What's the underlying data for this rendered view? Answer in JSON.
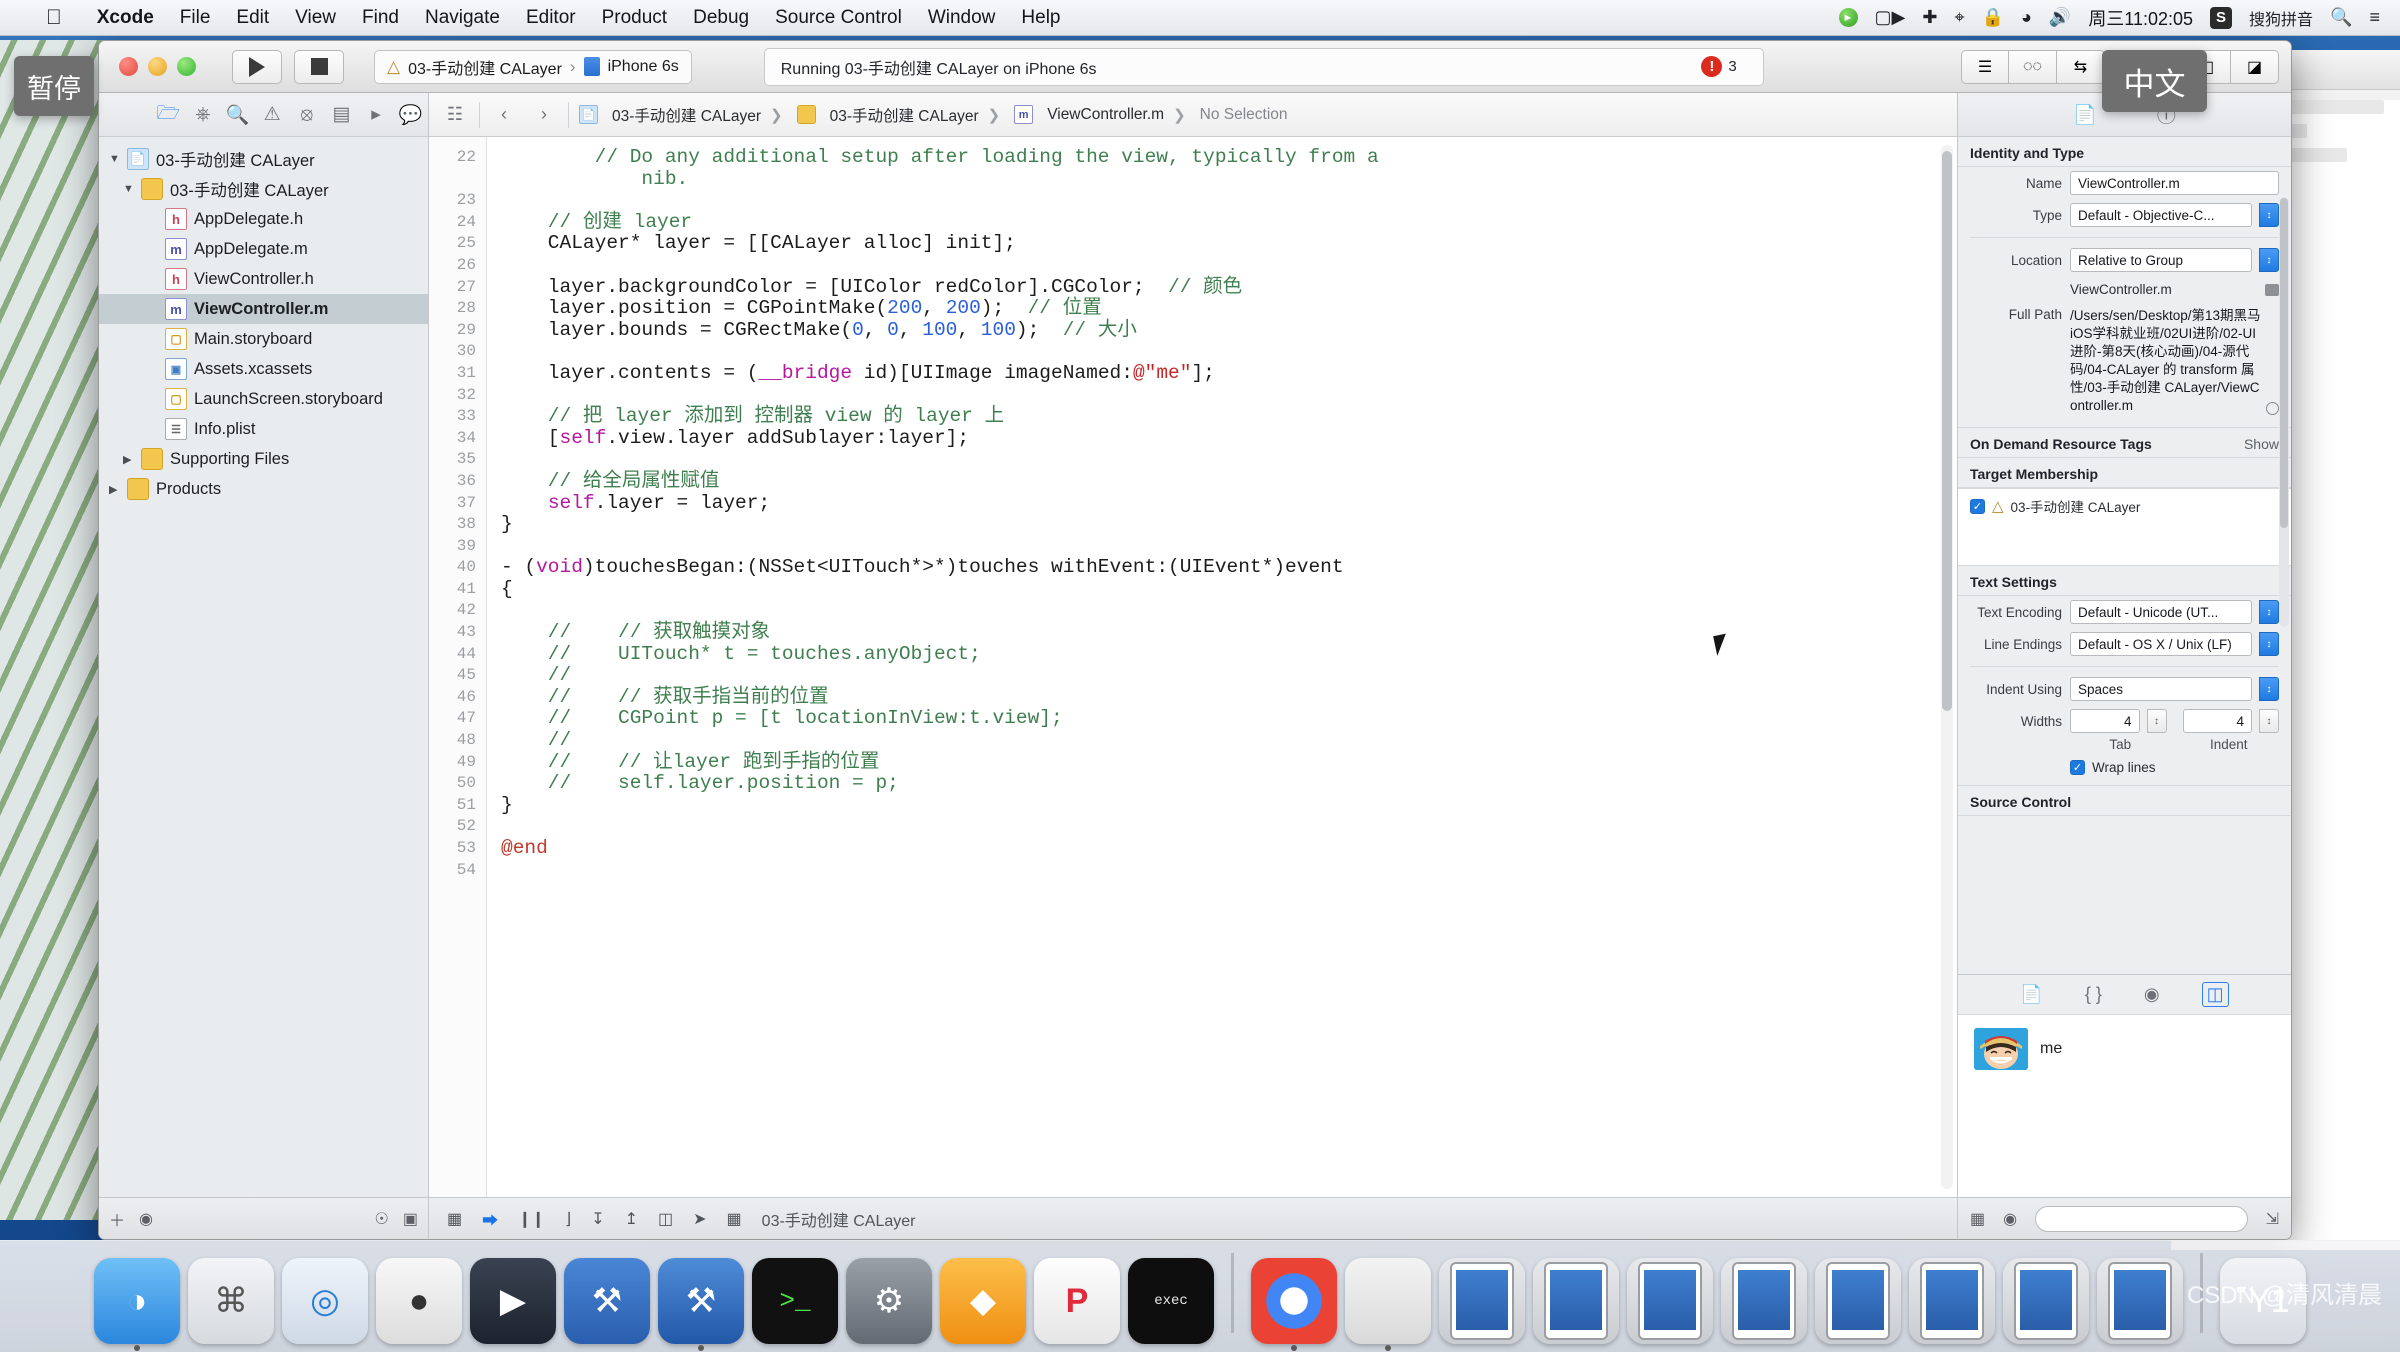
{
  "menubar": {
    "apple_icon": "apple-icon",
    "items": [
      {
        "label": "Xcode",
        "bold": true
      },
      {
        "label": "File",
        "bold": false
      },
      {
        "label": "Edit",
        "bold": false
      },
      {
        "label": "View",
        "bold": false
      },
      {
        "label": "Find",
        "bold": false
      },
      {
        "label": "Navigate",
        "bold": false
      },
      {
        "label": "Editor",
        "bold": false
      },
      {
        "label": "Product",
        "bold": false
      },
      {
        "label": "Debug",
        "bold": false
      },
      {
        "label": "Source Control",
        "bold": false
      },
      {
        "label": "Window",
        "bold": false
      },
      {
        "label": "Help",
        "bold": false
      }
    ],
    "status_items": {
      "screen_record_icon": "screen-record-icon",
      "video_icon": "video-camera-icon",
      "airplay_icon": "airplay-icon",
      "bluetooth_icon": "bluetooth-icon",
      "lock_icon": "lock-icon",
      "wifi_icon": "wifi-icon",
      "volume_icon": "volume-icon",
      "clock": "周三11:02:05",
      "input_badge": "S",
      "input_method": "搜狗拼音",
      "search_icon": "search-icon",
      "notification_icon": "notification-center-icon"
    }
  },
  "tooltips": {
    "pause": "暂停",
    "chinese": "中文"
  },
  "toolbar": {
    "run_label": "run-button",
    "stop_label": "stop-button",
    "scheme_target": "03-手动创建 CALayer",
    "scheme_separator": "›",
    "scheme_device": "iPhone 6s",
    "status_text": "Running 03-手动创建 CALayer on iPhone 6s",
    "error_count": "3",
    "editor_buttons": [
      "standard-editor",
      "assistant-editor",
      "version-editor"
    ],
    "view_buttons": [
      "navigator-toggle",
      "debug-area-toggle",
      "utilities-toggle"
    ]
  },
  "navigator": {
    "toolbar_icons": [
      "project-navigator-icon",
      "source-control-navigator-icon",
      "find-navigator-icon",
      "issue-navigator-icon",
      "test-navigator-icon",
      "debug-navigator-icon",
      "breakpoint-navigator-icon",
      "report-navigator-icon"
    ],
    "tree": [
      {
        "label": "03-手动创建 CALayer",
        "icon": "project-icon",
        "indent": 0,
        "twisty": "▼",
        "selected": false
      },
      {
        "label": "03-手动创建 CALayer",
        "icon": "folder-icon",
        "indent": 1,
        "twisty": "▼",
        "selected": false
      },
      {
        "label": "AppDelegate.h",
        "icon": "header-file-icon",
        "indent": 2,
        "twisty": "",
        "selected": false
      },
      {
        "label": "AppDelegate.m",
        "icon": "objc-file-icon",
        "indent": 2,
        "twisty": "",
        "selected": false
      },
      {
        "label": "ViewController.h",
        "icon": "header-file-icon",
        "indent": 2,
        "twisty": "",
        "selected": false
      },
      {
        "label": "ViewController.m",
        "icon": "objc-file-icon",
        "indent": 2,
        "twisty": "",
        "selected": true
      },
      {
        "label": "Main.storyboard",
        "icon": "storyboard-icon",
        "indent": 2,
        "twisty": "",
        "selected": false
      },
      {
        "label": "Assets.xcassets",
        "icon": "assets-icon",
        "indent": 2,
        "twisty": "",
        "selected": false
      },
      {
        "label": "LaunchScreen.storyboard",
        "icon": "storyboard-icon",
        "indent": 2,
        "twisty": "",
        "selected": false
      },
      {
        "label": "Info.plist",
        "icon": "plist-icon",
        "indent": 2,
        "twisty": "",
        "selected": false
      },
      {
        "label": "Supporting Files",
        "icon": "folder-icon",
        "indent": 1,
        "twisty": "▶",
        "selected": false
      },
      {
        "label": "Products",
        "icon": "folder-icon",
        "indent": 0,
        "twisty": "▶",
        "selected": false
      }
    ],
    "bottom_icons": [
      "add-icon",
      "filter-icon",
      "recent-icon",
      "source-control-filter-icon"
    ]
  },
  "editor": {
    "jumpbar_icons": [
      "related-items-icon",
      "back-arrow-icon",
      "forward-arrow-icon"
    ],
    "breadcrumb": [
      {
        "label": "03-手动创建 CALayer",
        "icon": "project-icon"
      },
      {
        "label": "03-手动创建 CALayer",
        "icon": "folder-icon"
      },
      {
        "label": "ViewController.m",
        "icon": "objc-file-icon"
      },
      {
        "label": "No Selection",
        "icon": ""
      }
    ],
    "first_line_number": 22,
    "lines": [
      {
        "n": 22,
        "segments": [
          {
            "t": "        // Do any additional setup after loading the view, typically from a",
            "c": "cmt"
          }
        ]
      },
      {
        "n": "",
        "segments": [
          {
            "t": "            nib.",
            "c": "cmt"
          }
        ]
      },
      {
        "n": 23,
        "segments": []
      },
      {
        "n": 24,
        "segments": [
          {
            "t": "    // 创建 layer",
            "c": "cmt"
          }
        ]
      },
      {
        "n": 25,
        "segments": [
          {
            "t": "    CALayer* layer = [[CALayer alloc] init];",
            "c": ""
          }
        ]
      },
      {
        "n": 26,
        "segments": []
      },
      {
        "n": 27,
        "segments": [
          {
            "t": "    layer.backgroundColor = [UIColor redColor].CGColor;  ",
            "c": ""
          },
          {
            "t": "// 颜色",
            "c": "cmt"
          }
        ]
      },
      {
        "n": 28,
        "segments": [
          {
            "t": "    layer.position = CGPointMake(",
            "c": ""
          },
          {
            "t": "200",
            "c": "num"
          },
          {
            "t": ", ",
            "c": ""
          },
          {
            "t": "200",
            "c": "num"
          },
          {
            "t": ");  ",
            "c": ""
          },
          {
            "t": "// 位置",
            "c": "cmt"
          }
        ]
      },
      {
        "n": 29,
        "segments": [
          {
            "t": "    layer.bounds = CGRectMake(",
            "c": ""
          },
          {
            "t": "0",
            "c": "num"
          },
          {
            "t": ", ",
            "c": ""
          },
          {
            "t": "0",
            "c": "num"
          },
          {
            "t": ", ",
            "c": ""
          },
          {
            "t": "100",
            "c": "num"
          },
          {
            "t": ", ",
            "c": ""
          },
          {
            "t": "100",
            "c": "num"
          },
          {
            "t": ");  ",
            "c": ""
          },
          {
            "t": "// 大小",
            "c": "cmt"
          }
        ]
      },
      {
        "n": 30,
        "segments": []
      },
      {
        "n": 31,
        "segments": [
          {
            "t": "    layer.contents = (",
            "c": ""
          },
          {
            "t": "__bridge",
            "c": "kw"
          },
          {
            "t": " id)[UIImage imageNamed:",
            "c": ""
          },
          {
            "t": "@\"me\"",
            "c": "str"
          },
          {
            "t": "];",
            "c": ""
          }
        ]
      },
      {
        "n": 32,
        "segments": []
      },
      {
        "n": 33,
        "segments": [
          {
            "t": "    // 把 layer 添加到 控制器 view 的 layer 上",
            "c": "cmt"
          }
        ]
      },
      {
        "n": 34,
        "segments": [
          {
            "t": "    [",
            "c": ""
          },
          {
            "t": "self",
            "c": "kw"
          },
          {
            "t": ".view.layer addSublayer:layer];",
            "c": ""
          }
        ]
      },
      {
        "n": 35,
        "segments": []
      },
      {
        "n": 36,
        "segments": [
          {
            "t": "    // 给全局属性赋值",
            "c": "cmt"
          }
        ]
      },
      {
        "n": 37,
        "segments": [
          {
            "t": "    ",
            "c": ""
          },
          {
            "t": "self",
            "c": "kw"
          },
          {
            "t": ".layer = layer;",
            "c": ""
          }
        ]
      },
      {
        "n": 38,
        "segments": [
          {
            "t": "}",
            "c": ""
          }
        ]
      },
      {
        "n": 39,
        "segments": []
      },
      {
        "n": 40,
        "segments": [
          {
            "t": "- (",
            "c": ""
          },
          {
            "t": "void",
            "c": "kw"
          },
          {
            "t": ")touchesBegan:(NSSet<UITouch*>*)touches withEvent:(UIEvent*)event",
            "c": ""
          }
        ]
      },
      {
        "n": 41,
        "segments": [
          {
            "t": "{",
            "c": ""
          }
        ]
      },
      {
        "n": 42,
        "segments": []
      },
      {
        "n": 43,
        "segments": [
          {
            "t": "    //    // 获取触摸对象",
            "c": "cmt"
          }
        ]
      },
      {
        "n": 44,
        "segments": [
          {
            "t": "    //    UITouch* t = touches.anyObject;",
            "c": "cmt"
          }
        ]
      },
      {
        "n": 45,
        "segments": [
          {
            "t": "    //",
            "c": "cmt"
          }
        ]
      },
      {
        "n": 46,
        "segments": [
          {
            "t": "    //    // 获取手指当前的位置",
            "c": "cmt"
          }
        ]
      },
      {
        "n": 47,
        "segments": [
          {
            "t": "    //    CGPoint p = [t locationInView:t.view];",
            "c": "cmt"
          }
        ]
      },
      {
        "n": 48,
        "segments": [
          {
            "t": "    //",
            "c": "cmt"
          }
        ]
      },
      {
        "n": 49,
        "segments": [
          {
            "t": "    //    // 让layer 跑到手指的位置",
            "c": "cmt"
          }
        ]
      },
      {
        "n": 50,
        "segments": [
          {
            "t": "    //    self.layer.position = p;",
            "c": "cmt"
          }
        ]
      },
      {
        "n": 51,
        "segments": [
          {
            "t": "}",
            "c": ""
          }
        ]
      },
      {
        "n": 52,
        "segments": []
      },
      {
        "n": 53,
        "segments": [
          {
            "t": "@end",
            "c": "atk"
          }
        ]
      },
      {
        "n": 54,
        "segments": []
      }
    ],
    "bottom_bar": {
      "icons": [
        "show-debug-area-icon",
        "breakpoints-icon",
        "pause-icon",
        "step-over-icon",
        "step-into-icon",
        "step-out-icon",
        "view-hierarchy-icon",
        "location-icon",
        "memory-graph-icon"
      ],
      "process_label": "03-手动创建 CALayer"
    }
  },
  "inspector": {
    "toolbar_icons": [
      "file-inspector-icon",
      "quick-help-icon"
    ],
    "identity_section": {
      "title": "Identity and Type",
      "name_label": "Name",
      "name_value": "ViewController.m",
      "type_label": "Type",
      "type_value": "Default - Objective-C...",
      "location_label": "Location",
      "location_value": "Relative to Group",
      "location_file": "ViewController.m",
      "full_path_label": "Full Path",
      "full_path_value": "/Users/sen/Desktop/第13期黑马iOS学科就业班/02UI进阶/02-UI进阶-第8天(核心动画)/04-源代码/04-CALayer 的 transform 属性/03-手动创建 CALayer/ViewController.m"
    },
    "on_demand_section": {
      "title": "On Demand Resource Tags",
      "show_label": "Show"
    },
    "target_membership": {
      "title": "Target Membership",
      "checked": true,
      "target_name": "03-手动创建 CALayer"
    },
    "text_settings": {
      "title": "Text Settings",
      "encoding_label": "Text Encoding",
      "encoding_value": "Default - Unicode (UT...",
      "line_endings_label": "Line Endings",
      "line_endings_value": "Default - OS X / Unix (LF)",
      "indent_label": "Indent Using",
      "indent_value": "Spaces",
      "widths_label": "Widths",
      "tab_value": "4",
      "tab_caption": "Tab",
      "indent_width_value": "4",
      "indent_caption": "Indent",
      "wrap_lines_label": "Wrap lines",
      "wrap_lines_checked": true
    },
    "source_control": {
      "title": "Source Control"
    }
  },
  "library": {
    "tabs": [
      "file-template-library-icon",
      "code-snippet-library-icon",
      "object-library-icon",
      "media-library-icon"
    ],
    "selected_tab_index": 3,
    "items": [
      {
        "label": "me",
        "thumb": "luffy-avatar"
      }
    ],
    "bottom_icons": [
      "library-grid-icon",
      "library-filter-icon"
    ],
    "search_placeholder": ""
  },
  "dock": {
    "items": [
      {
        "name": "finder-icon",
        "glyph": "◑",
        "cls": "finder",
        "running": true
      },
      {
        "name": "launchpad-icon",
        "glyph": "⌘",
        "cls": "launch",
        "running": false
      },
      {
        "name": "safari-icon",
        "glyph": "◎",
        "cls": "safari",
        "running": false
      },
      {
        "name": "brave-browser-icon",
        "glyph": "●",
        "cls": "brave",
        "running": false
      },
      {
        "name": "video-player-icon",
        "glyph": "▶",
        "cls": "video",
        "running": false
      },
      {
        "name": "utilities-icon",
        "glyph": "⚒",
        "cls": "tools",
        "running": false
      },
      {
        "name": "xcode-icon",
        "glyph": "⚒",
        "cls": "xcode",
        "running": true
      },
      {
        "name": "terminal-icon",
        "glyph": ">_",
        "cls": "term",
        "running": false
      },
      {
        "name": "system-preferences-icon",
        "glyph": "⚙",
        "cls": "prefs",
        "running": false
      },
      {
        "name": "sketch-icon",
        "glyph": "◆",
        "cls": "sketch",
        "running": false
      },
      {
        "name": "pdf-reader-icon",
        "glyph": "P",
        "cls": "p",
        "running": false
      },
      {
        "name": "executable-icon",
        "glyph": "exec",
        "cls": "exec",
        "running": false
      },
      {
        "name": "chrome-icon",
        "glyph": "",
        "cls": "chrome",
        "running": true
      },
      {
        "name": "window-icon",
        "glyph": "",
        "cls": "win",
        "running": true
      },
      {
        "name": "simulator-icon-1",
        "glyph": "",
        "cls": "sim",
        "running": false
      },
      {
        "name": "simulator-icon-2",
        "glyph": "",
        "cls": "sim",
        "running": false
      },
      {
        "name": "simulator-icon-3",
        "glyph": "",
        "cls": "sim",
        "running": false
      },
      {
        "name": "simulator-icon-4",
        "glyph": "",
        "cls": "sim",
        "running": false
      },
      {
        "name": "simulator-icon-5",
        "glyph": "",
        "cls": "sim",
        "running": false
      },
      {
        "name": "simulator-icon-6",
        "glyph": "",
        "cls": "sim",
        "running": false
      },
      {
        "name": "simulator-icon-7",
        "glyph": "",
        "cls": "sim",
        "running": false
      },
      {
        "name": "simulator-icon-8",
        "glyph": "",
        "cls": "sim",
        "running": false
      },
      {
        "name": "trash-icon",
        "glyph": "Ὕ1",
        "cls": "trash",
        "running": false
      }
    ]
  },
  "watermark": "CSDN @清风清晨",
  "colors": {
    "accent_blue": "#2d7ff0",
    "comment_green": "#3f7f4f",
    "number_blue": "#2b5fd9",
    "string_red": "#c62828",
    "keyword_magenta": "#b5179e",
    "error_red": "#dd2a1f",
    "selection_gray": "#c3cdd2"
  }
}
